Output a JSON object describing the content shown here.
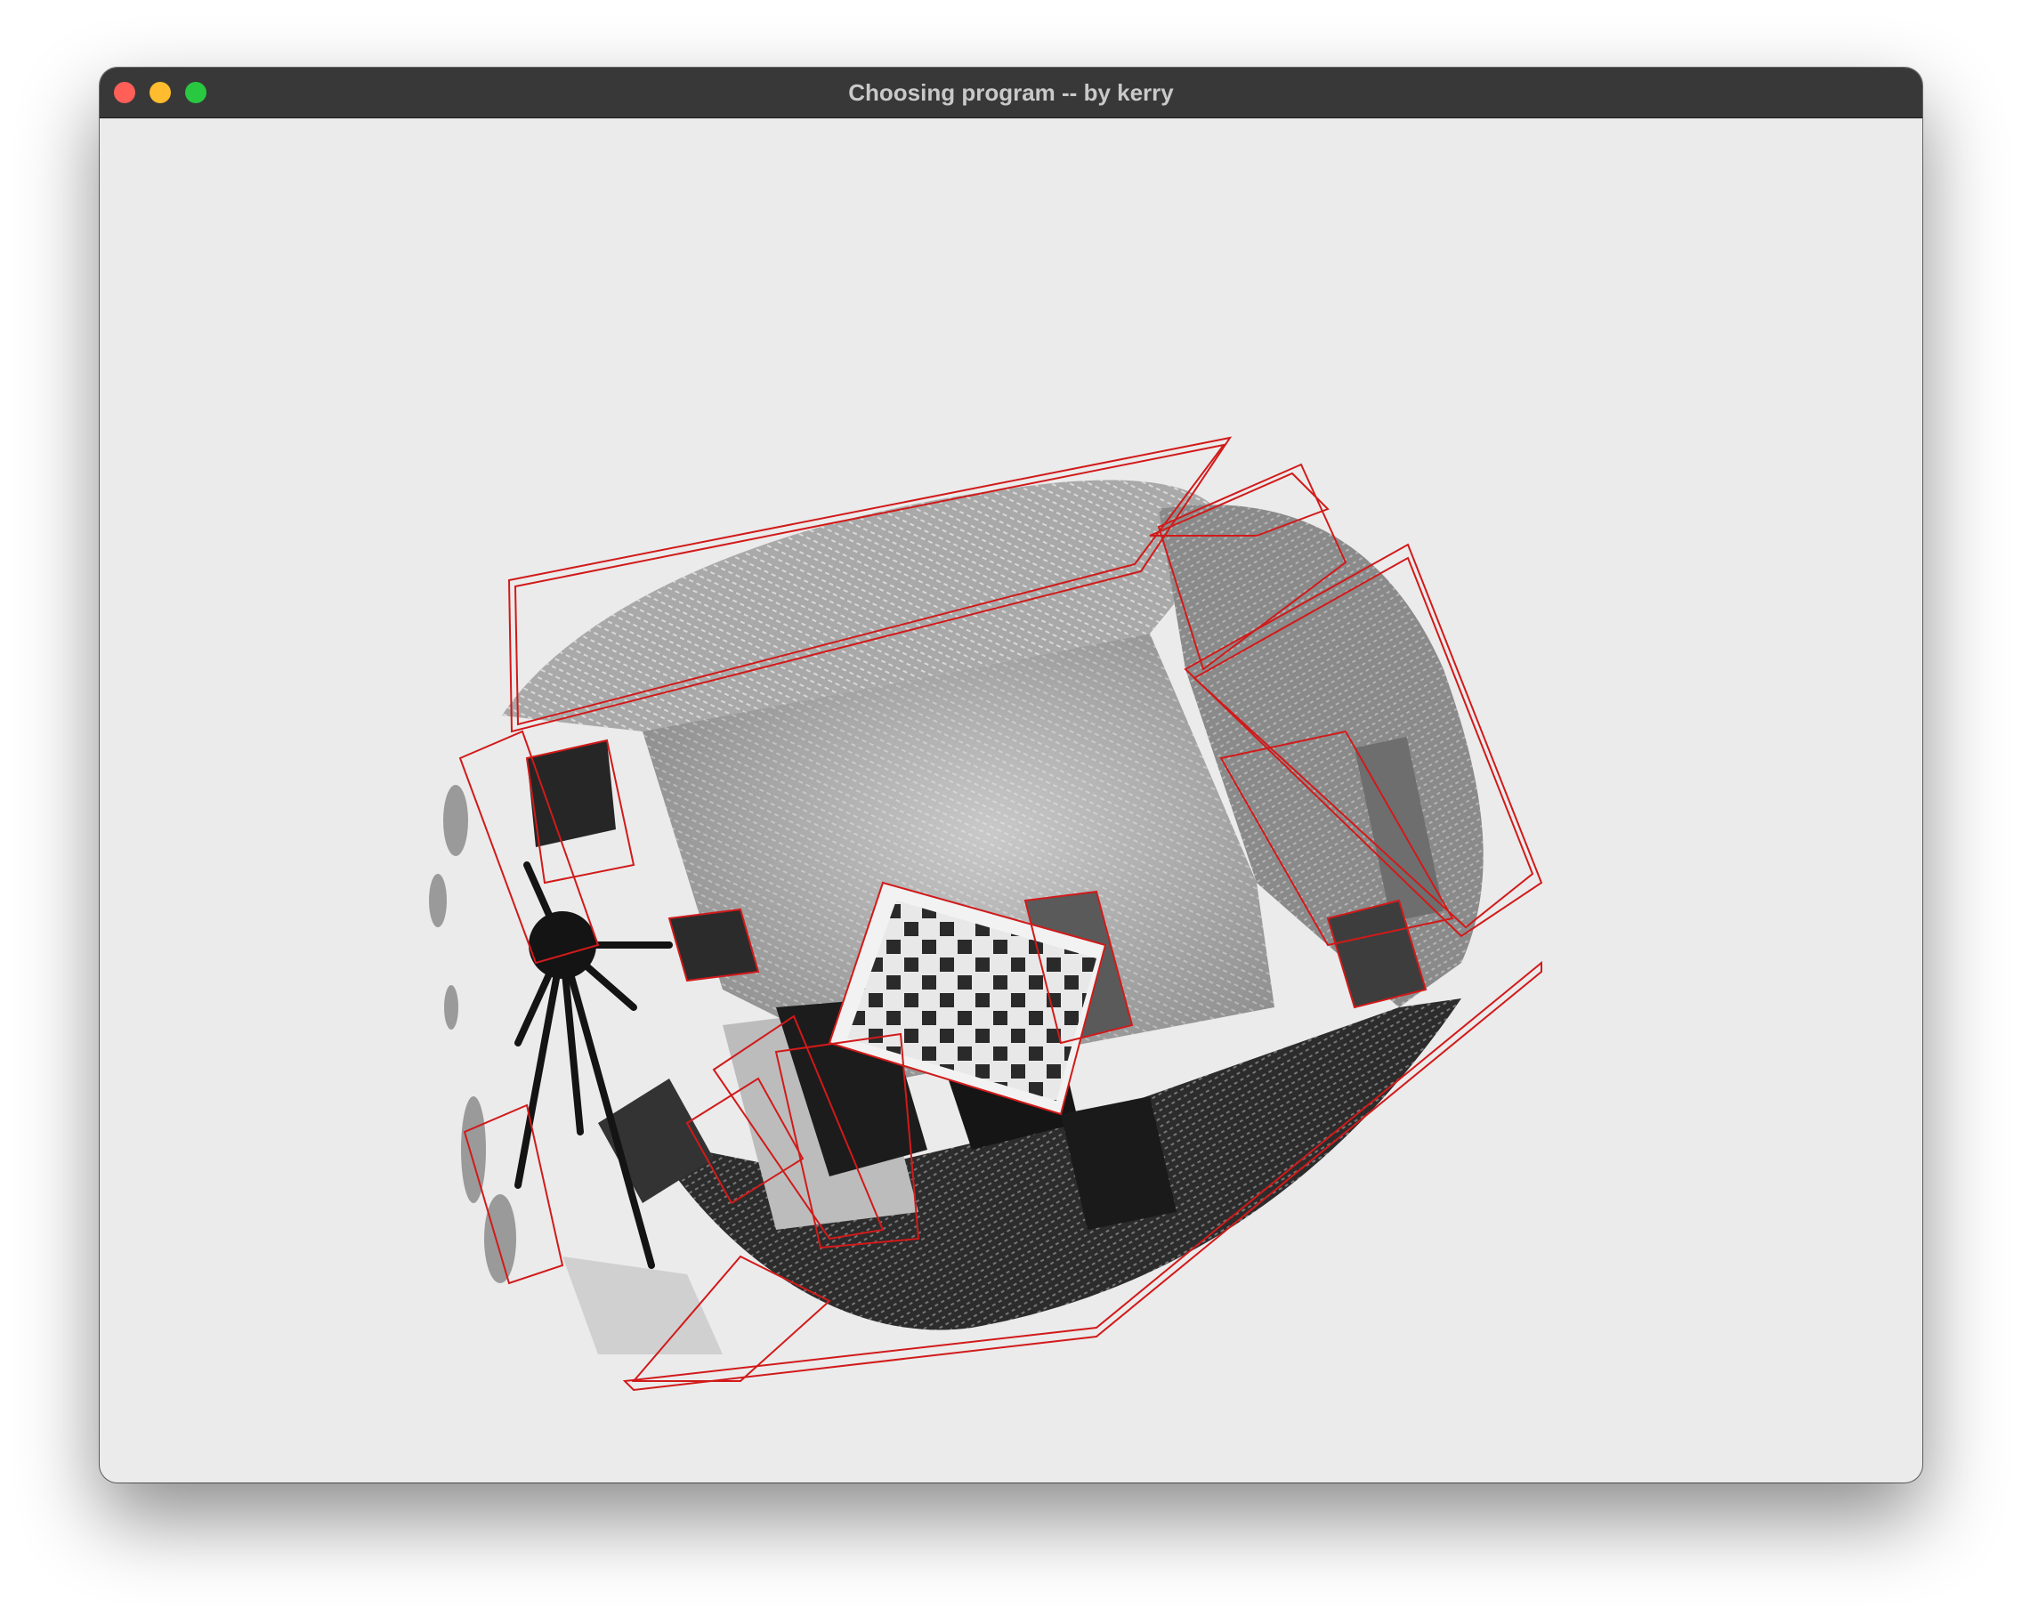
{
  "window": {
    "title": "Choosing program -- by kerry"
  },
  "titlebar": {
    "buttons": [
      {
        "name": "close",
        "color": "#ff5f57"
      },
      {
        "name": "minimize",
        "color": "#febc2e"
      },
      {
        "name": "maximize",
        "color": "#28c840"
      }
    ]
  },
  "viewport": {
    "background": "#ebebeb",
    "content": "3d-point-cloud-render",
    "point_color": "grayscale",
    "outline_color": "#d11a1a"
  }
}
